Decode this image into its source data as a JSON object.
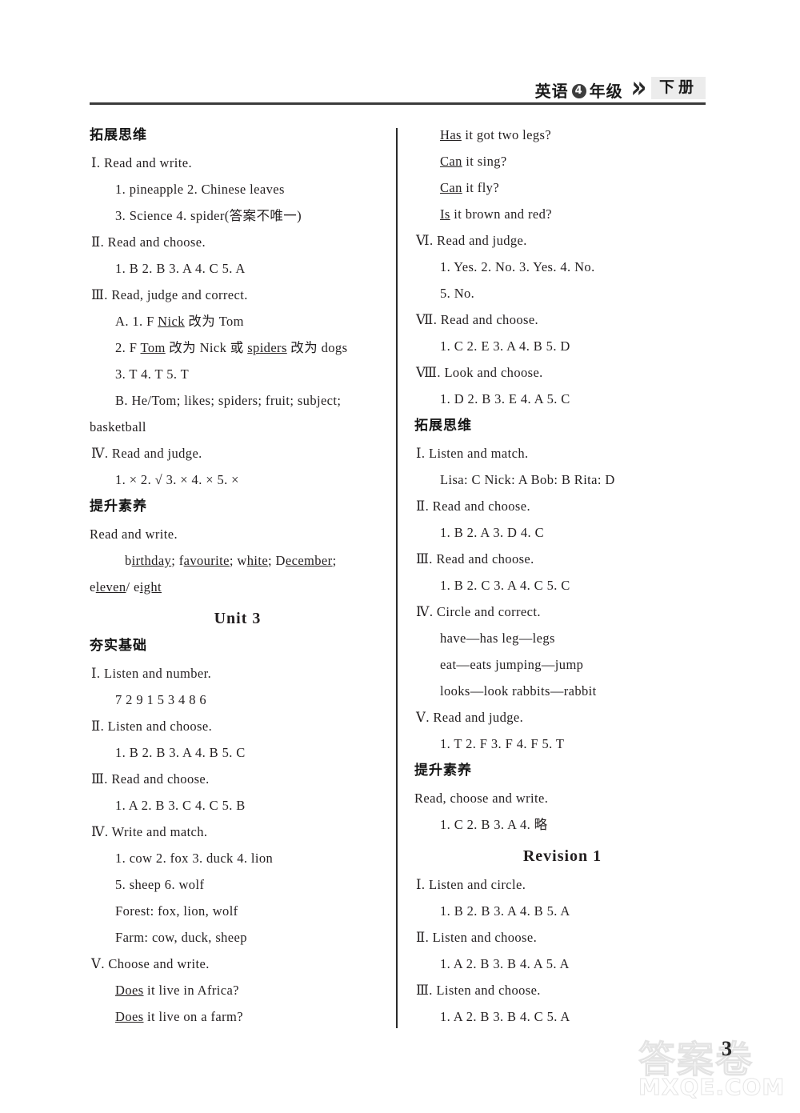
{
  "header": {
    "subject": "英语",
    "grade_circle": "4",
    "grade_suffix": "年级",
    "chevron": "》",
    "volume": "下册"
  },
  "left_column": {
    "blocks": [
      {
        "kind": "cn-head",
        "text": "拓展思维"
      },
      {
        "kind": "ex",
        "text": "Ⅰ. Read and write."
      },
      {
        "kind": "ans",
        "text": "1. pineapple   2. Chinese leaves"
      },
      {
        "kind": "ans",
        "text": "3. Science   4. spider(答案不唯一)"
      },
      {
        "kind": "ex",
        "text": "Ⅱ. Read and choose."
      },
      {
        "kind": "ans",
        "text": "1. B  2. B  3. A  4. C  5. A"
      },
      {
        "kind": "ex",
        "text": "Ⅲ. Read, judge and correct."
      },
      {
        "kind": "ans_html",
        "text": "A. 1. F    <u>Nick</u> 改为 Tom"
      },
      {
        "kind": "ans_html",
        "text": "2. F    <u>Tom</u> 改为 Nick 或 <u>spiders</u> 改为 dogs"
      },
      {
        "kind": "ans",
        "text": "3. T   4. T   5. T"
      },
      {
        "kind": "ans",
        "text": "B. He/Tom; likes; spiders; fruit; subject;"
      },
      {
        "kind": "flush",
        "text": "basketball"
      },
      {
        "kind": "ex",
        "text": "Ⅳ. Read and judge."
      },
      {
        "kind": "ans",
        "text": "1. ×   2. √   3. ×   4. ×   5. ×"
      },
      {
        "kind": "cn-head",
        "text": "提升素养"
      },
      {
        "kind": "flush",
        "text": "Read and write."
      },
      {
        "kind": "indent_html",
        "text": "b<u>irthday</u>; f<u>avourite</u>; w<u>hite</u>; D<u>ecember</u>;"
      },
      {
        "kind": "flush_html",
        "text": "e<u>leven</u>/ e<u>ight</u>"
      },
      {
        "kind": "unit",
        "text": "Unit 3"
      },
      {
        "kind": "cn-head",
        "text": "夯实基础"
      },
      {
        "kind": "ex",
        "text": "Ⅰ. Listen and number."
      },
      {
        "kind": "ans",
        "text": "7  2  9    1  5  3     4  8  6"
      },
      {
        "kind": "ex",
        "text": "Ⅱ. Listen and choose."
      },
      {
        "kind": "ans",
        "text": "1. B  2. B  3. A  4. B  5. C"
      },
      {
        "kind": "ex",
        "text": "Ⅲ. Read and choose."
      },
      {
        "kind": "ans",
        "text": "1. A  2. B  3. C  4. C  5. B"
      },
      {
        "kind": "ex",
        "text": "Ⅳ. Write and match."
      },
      {
        "kind": "ans",
        "text": "1. cow   2. fox   3. duck   4. lion"
      },
      {
        "kind": "ans",
        "text": "5. sheep   6. wolf"
      },
      {
        "kind": "sub",
        "text": "Forest: fox, lion, wolf"
      },
      {
        "kind": "sub",
        "text": "Farm: cow, duck, sheep"
      },
      {
        "kind": "ex",
        "text": "Ⅴ. Choose and write."
      },
      {
        "kind": "sub_html",
        "text": "<u>Does</u> it live in Africa?"
      },
      {
        "kind": "sub_html",
        "text": "<u>Does</u> it live on a farm?"
      }
    ]
  },
  "right_column": {
    "blocks": [
      {
        "kind": "sub_html",
        "text": "<u>Has</u> it got two legs?"
      },
      {
        "kind": "sub_html",
        "text": "<u>Can</u> it sing?"
      },
      {
        "kind": "sub_html",
        "text": "<u>Can</u> it fly?"
      },
      {
        "kind": "sub_html",
        "text": "<u>Is</u> it brown and red?"
      },
      {
        "kind": "ex",
        "text": "Ⅵ. Read and judge."
      },
      {
        "kind": "ans",
        "text": "1. Yes.   2. No.   3. Yes.   4. No."
      },
      {
        "kind": "ans",
        "text": "5. No."
      },
      {
        "kind": "ex",
        "text": "Ⅶ. Read and choose."
      },
      {
        "kind": "ans",
        "text": "1. C  2. E  3. A  4. B  5. D"
      },
      {
        "kind": "ex",
        "text": "Ⅷ. Look and choose."
      },
      {
        "kind": "ans",
        "text": "1. D  2. B  3. E  4. A  5. C"
      },
      {
        "kind": "cn-head",
        "text": "拓展思维"
      },
      {
        "kind": "ex",
        "text": "Ⅰ. Listen and match."
      },
      {
        "kind": "sub",
        "text": "Lisa: C   Nick: A   Bob: B   Rita: D"
      },
      {
        "kind": "ex",
        "text": "Ⅱ. Read and choose."
      },
      {
        "kind": "ans",
        "text": "1. B  2. A  3. D  4. C"
      },
      {
        "kind": "ex",
        "text": "Ⅲ. Read and choose."
      },
      {
        "kind": "ans",
        "text": "1. B  2. C  3. A  4. C  5. C"
      },
      {
        "kind": "ex",
        "text": "Ⅳ. Circle and correct."
      },
      {
        "kind": "sub",
        "text": "have—has   leg—legs"
      },
      {
        "kind": "sub",
        "text": "eat—eats   jumping—jump"
      },
      {
        "kind": "sub",
        "text": "looks—look   rabbits—rabbit"
      },
      {
        "kind": "ex",
        "text": "Ⅴ. Read and judge."
      },
      {
        "kind": "ans",
        "text": "1. T  2. F  3. F  4. F  5. T"
      },
      {
        "kind": "cn-head",
        "text": "提升素养"
      },
      {
        "kind": "flush",
        "text": "Read, choose and write."
      },
      {
        "kind": "ans",
        "text": "1. C  2. B  3. A  4. 略"
      },
      {
        "kind": "unit",
        "text": "Revision 1"
      },
      {
        "kind": "ex",
        "text": "Ⅰ. Listen and circle."
      },
      {
        "kind": "ans",
        "text": "1. B  2. B  3. A  4. B  5. A"
      },
      {
        "kind": "ex",
        "text": "Ⅱ. Listen and choose."
      },
      {
        "kind": "ans",
        "text": "1. A  2. B  3. B  4. A  5. A"
      },
      {
        "kind": "ex",
        "text": "Ⅲ. Listen and choose."
      },
      {
        "kind": "ans",
        "text": "1. A  2. B  3. B  4. C  5. A"
      }
    ]
  },
  "footer": {
    "page_number": "3",
    "watermark_cn": "答案卷",
    "watermark_domain": "MXQE.COM"
  }
}
